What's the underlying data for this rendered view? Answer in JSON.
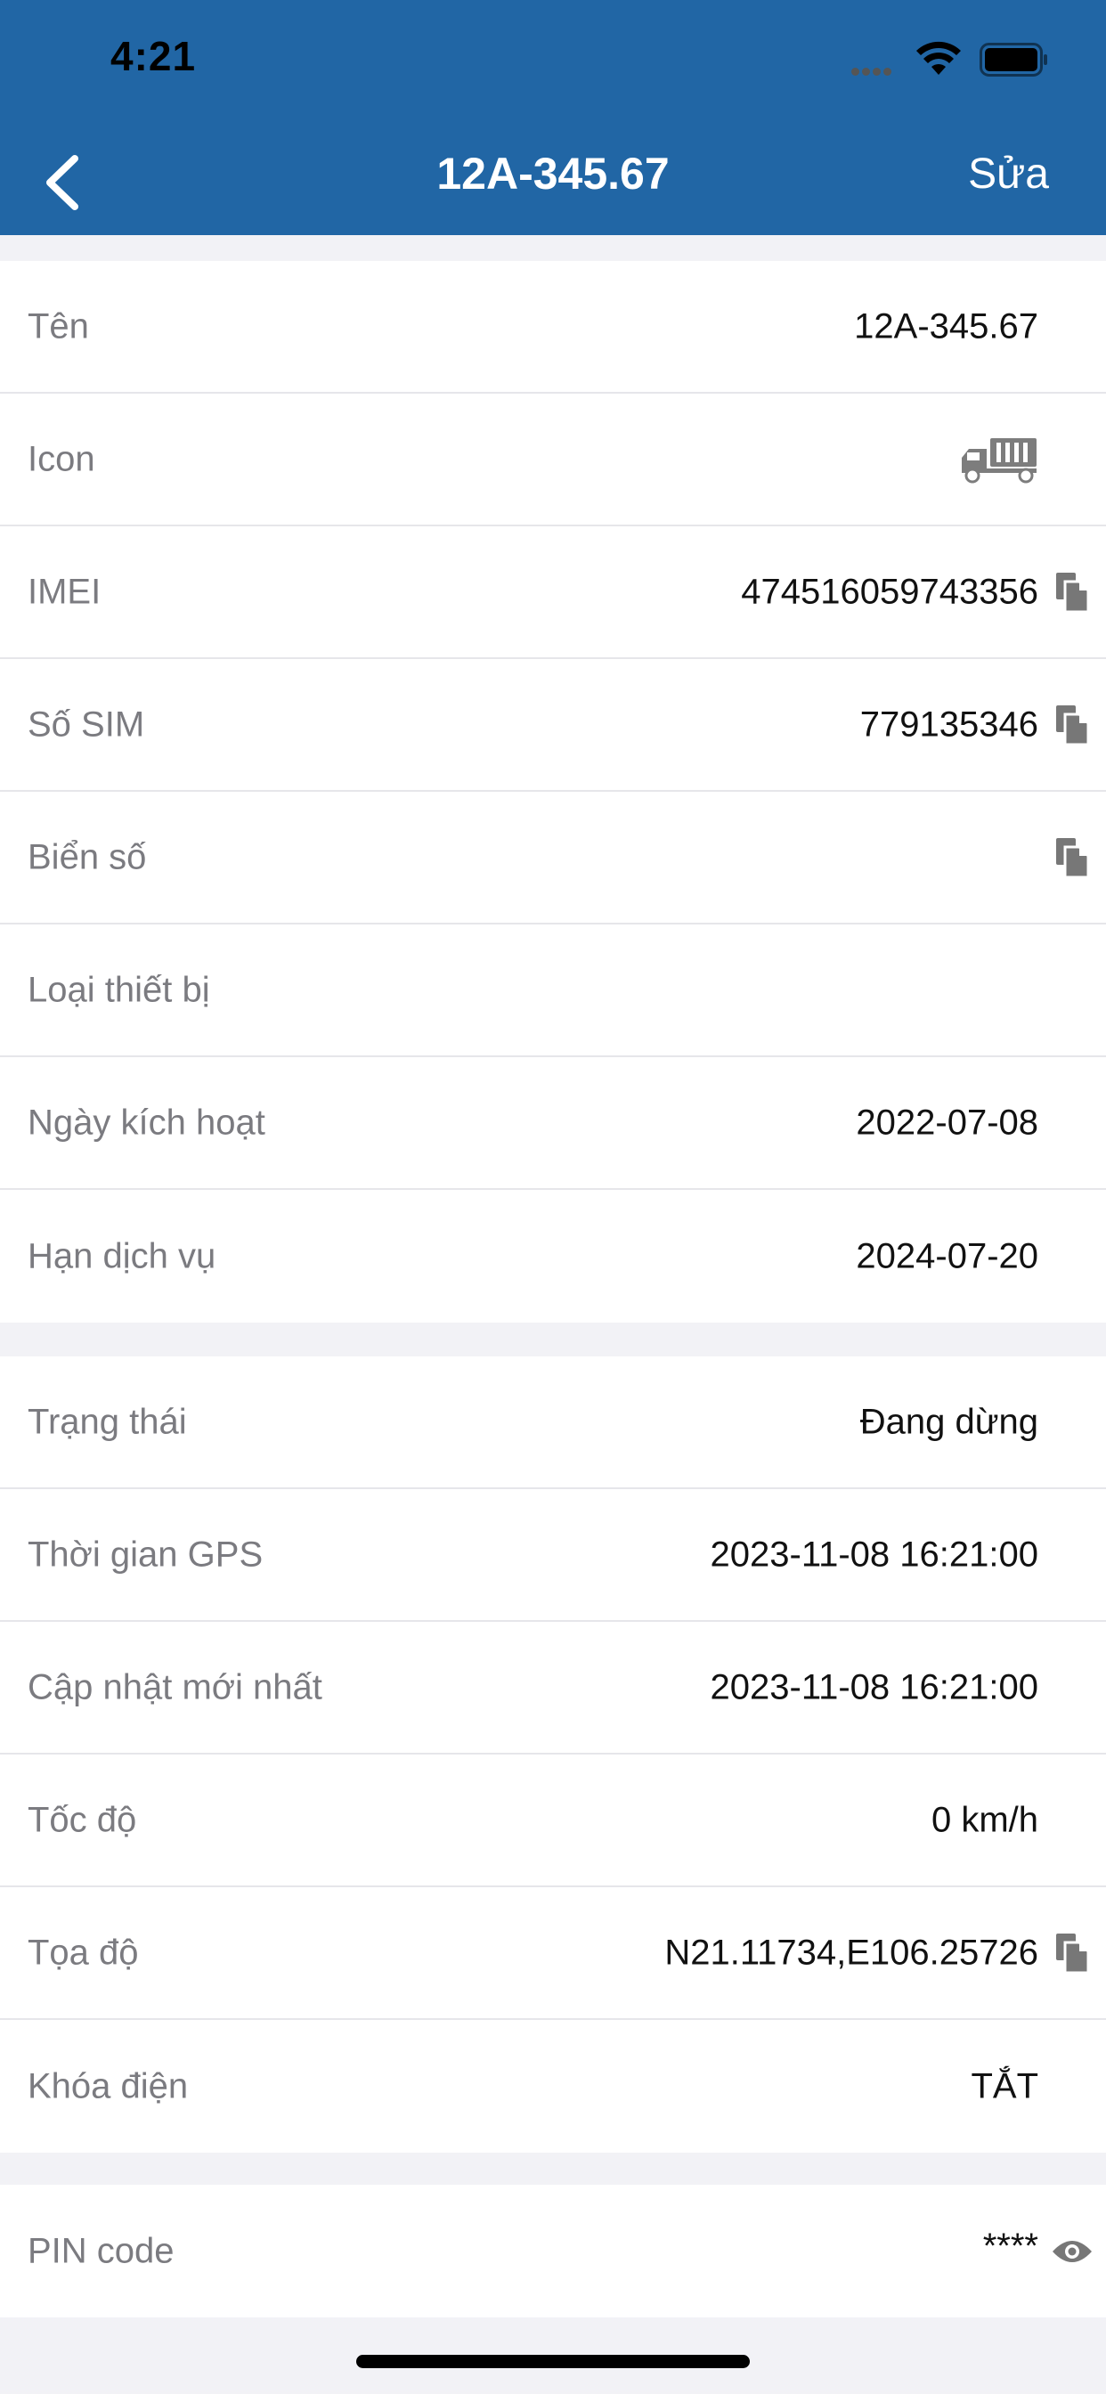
{
  "status_bar": {
    "time": "4:21"
  },
  "nav": {
    "title": "12A-345.67",
    "edit_label": "Sửa"
  },
  "section1": [
    {
      "label": "Tên",
      "value": "12A-345.67"
    },
    {
      "label": "Icon",
      "icon": "truck-icon"
    },
    {
      "label": "IMEI",
      "value": "474516059743356",
      "copy": true
    },
    {
      "label": "Số SIM",
      "value": "779135346",
      "copy": true
    },
    {
      "label": "Biển số",
      "value": "",
      "copy": true
    },
    {
      "label": "Loại thiết bị",
      "value": ""
    },
    {
      "label": "Ngày kích hoạt",
      "value": "2022-07-08"
    },
    {
      "label": "Hạn dịch vụ",
      "value": "2024-07-20"
    }
  ],
  "section2": [
    {
      "label": "Trạng thái",
      "value": "Đang dừng"
    },
    {
      "label": "Thời gian GPS",
      "value": "2023-11-08 16:21:00"
    },
    {
      "label": "Cập nhật mới nhất",
      "value": "2023-11-08 16:21:00"
    },
    {
      "label": "Tốc độ",
      "value": "0 km/h"
    },
    {
      "label": "Tọa độ",
      "value": "N21.11734,E106.25726",
      "copy": true
    },
    {
      "label": "Khóa điện",
      "value": "TẮT"
    }
  ],
  "section3": [
    {
      "label": "PIN code",
      "value": "****",
      "icon": "eye-icon"
    }
  ],
  "colors": {
    "header": "#2166a5",
    "background": "#f2f2f6",
    "label": "#7b7b80"
  }
}
